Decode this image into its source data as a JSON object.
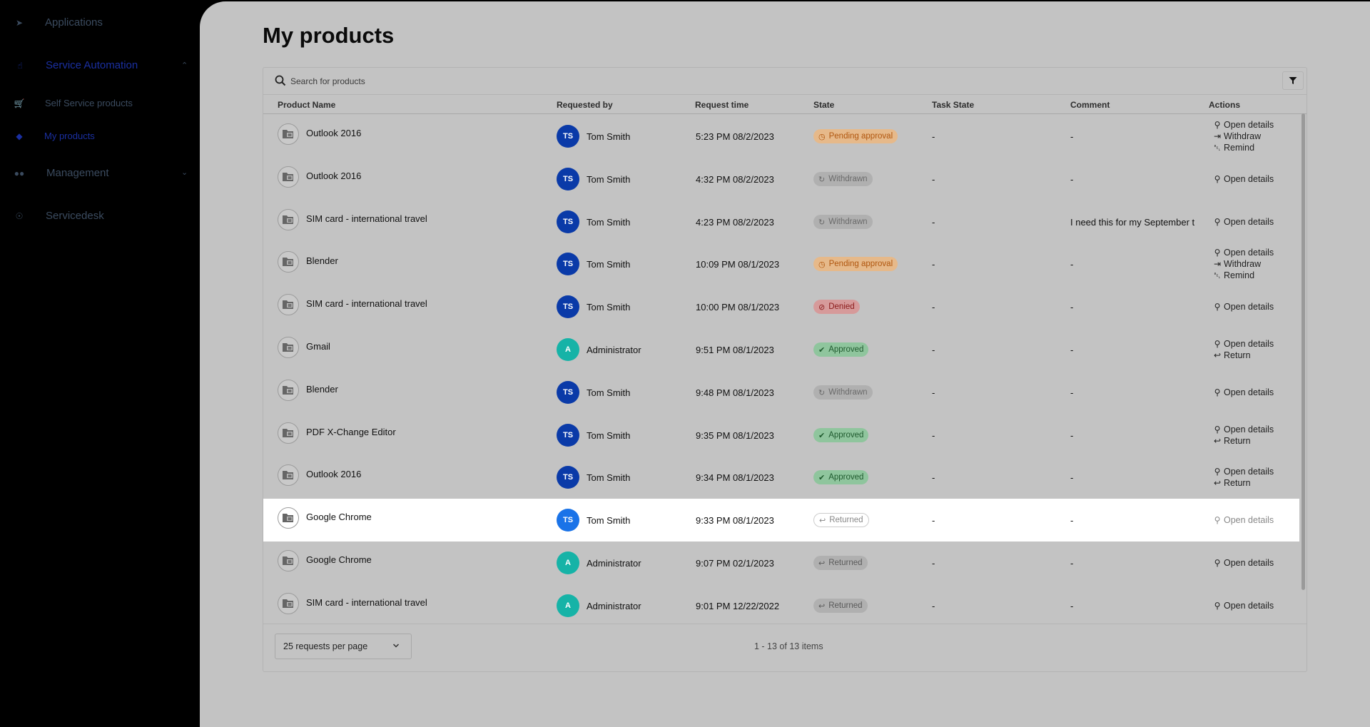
{
  "sidebar": {
    "items": [
      {
        "label": "Applications",
        "icon": "rocket-icon"
      },
      {
        "label": "Service Automation",
        "icon": "hand-pointer-icon"
      },
      {
        "label": "Self Service products",
        "icon": "cart-icon"
      },
      {
        "label": "My products",
        "icon": "tag-icon"
      },
      {
        "label": "Management",
        "icon": "users-icon"
      },
      {
        "label": "Servicedesk",
        "icon": "lifebuoy-icon"
      }
    ]
  },
  "page": {
    "title": "My products"
  },
  "search": {
    "placeholder": "Search for products"
  },
  "table": {
    "columns": [
      "Product Name",
      "Requested by",
      "Request time",
      "State",
      "Task State",
      "Comment",
      "Actions"
    ],
    "rows": [
      {
        "product": "Outlook 2016",
        "initials": "TS",
        "requester": "Tom Smith",
        "time": "5:23 PM 08/2/2023",
        "state": "Pending approval",
        "task": "-",
        "comment": "-",
        "actions": [
          "Open details",
          "Withdraw",
          "Remind"
        ]
      },
      {
        "product": "Outlook 2016",
        "initials": "TS",
        "requester": "Tom Smith",
        "time": "4:32 PM 08/2/2023",
        "state": "Withdrawn",
        "task": "-",
        "comment": "-",
        "actions": [
          "Open details"
        ]
      },
      {
        "product": "SIM card - international travel",
        "initials": "TS",
        "requester": "Tom Smith",
        "time": "4:23 PM 08/2/2023",
        "state": "Withdrawn",
        "task": "-",
        "comment": "I need this for my September t",
        "actions": [
          "Open details"
        ]
      },
      {
        "product": "Blender",
        "initials": "TS",
        "requester": "Tom Smith",
        "time": "10:09 PM 08/1/2023",
        "state": "Pending approval",
        "task": "-",
        "comment": "-",
        "actions": [
          "Open details",
          "Withdraw",
          "Remind"
        ]
      },
      {
        "product": "SIM card - international travel",
        "initials": "TS",
        "requester": "Tom Smith",
        "time": "10:00 PM 08/1/2023",
        "state": "Denied",
        "task": "-",
        "comment": "-",
        "actions": [
          "Open details"
        ]
      },
      {
        "product": "Gmail",
        "initials": "A",
        "requester": "Administrator",
        "time": "9:51 PM 08/1/2023",
        "state": "Approved",
        "task": "-",
        "comment": "-",
        "actions": [
          "Open details",
          "Return"
        ]
      },
      {
        "product": "Blender",
        "initials": "TS",
        "requester": "Tom Smith",
        "time": "9:48 PM 08/1/2023",
        "state": "Withdrawn",
        "task": "-",
        "comment": "-",
        "actions": [
          "Open details"
        ]
      },
      {
        "product": "PDF X-Change Editor",
        "initials": "TS",
        "requester": "Tom Smith",
        "time": "9:35 PM 08/1/2023",
        "state": "Approved",
        "task": "-",
        "comment": "-",
        "actions": [
          "Open details",
          "Return"
        ]
      },
      {
        "product": "Outlook 2016",
        "initials": "TS",
        "requester": "Tom Smith",
        "time": "9:34 PM 08/1/2023",
        "state": "Approved",
        "task": "-",
        "comment": "-",
        "actions": [
          "Open details",
          "Return"
        ]
      },
      {
        "product": "Google Chrome",
        "initials": "TS",
        "requester": "Tom Smith",
        "time": "9:33 PM 08/1/2023",
        "state": "Returned",
        "task": "-",
        "comment": "-",
        "actions": [
          "Open details"
        ]
      },
      {
        "product": "Google Chrome",
        "initials": "A",
        "requester": "Administrator",
        "time": "9:07 PM 02/1/2023",
        "state": "Returned",
        "task": "-",
        "comment": "-",
        "actions": [
          "Open details"
        ]
      },
      {
        "product": "SIM card - international travel",
        "initials": "A",
        "requester": "Administrator",
        "time": "9:01 PM 12/22/2022",
        "state": "Returned",
        "task": "-",
        "comment": "-",
        "actions": [
          "Open details"
        ]
      }
    ]
  },
  "footer": {
    "per_page": "25 requests per page",
    "pager": "1 - 13 of 13 items"
  },
  "colors": {
    "avatar_ts": "#0a3aa8",
    "avatar_ts_highlight": "#1a73e8",
    "avatar_admin": "#16b3a7",
    "pending_bg": "#e6b98a",
    "pending_fg": "#b0560e",
    "withdrawn_bg": "#b0b0b0",
    "withdrawn_fg": "#6a6a6a",
    "denied_bg": "#d69a9a",
    "denied_fg": "#8a1a1a",
    "approved_bg": "#8fc59d",
    "approved_fg": "#1f5a2e",
    "returned_bg": "#b0b0b0",
    "returned_fg": "#5a5a5a",
    "accent": "#1a2fa0"
  }
}
